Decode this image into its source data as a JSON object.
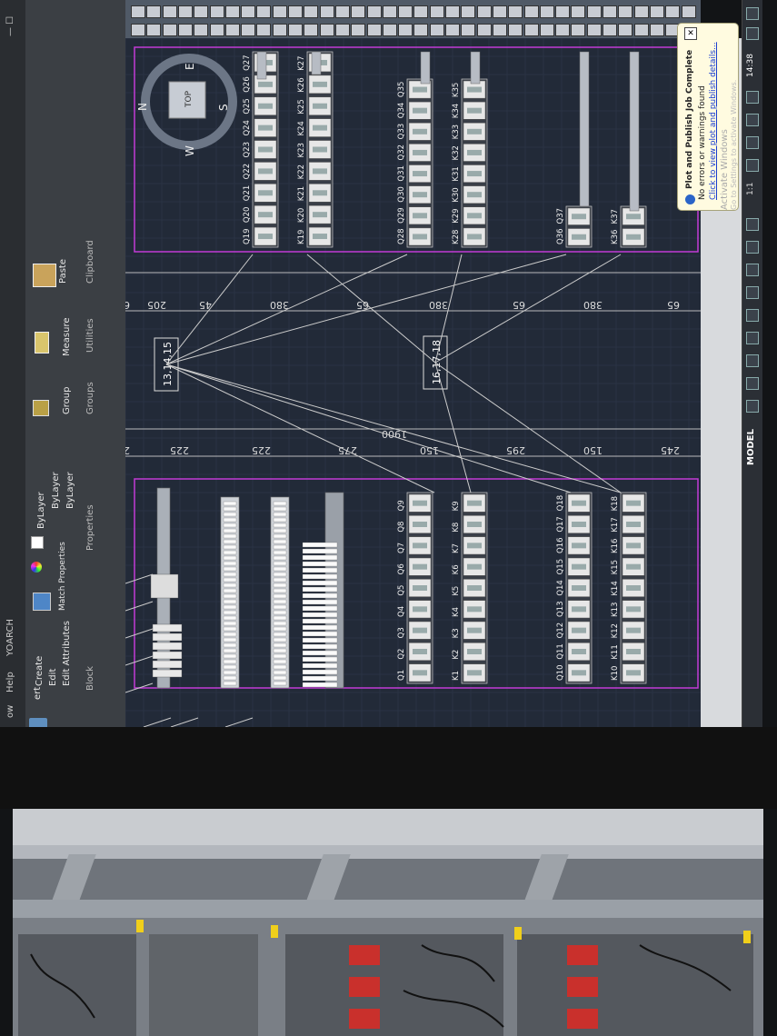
{
  "window": {
    "title_fragment": "YOARCH",
    "menu_help": "Help",
    "menu_window": "ow"
  },
  "ribbon": {
    "block_group": {
      "create": "Create",
      "edit": "Edit",
      "edit_attributes": "Edit Attributes",
      "group_label": "Block",
      "insert_partial": "ert"
    },
    "properties_group": {
      "match_properties": "Match\nProperties",
      "layer_1": "ByLayer",
      "layer_2": "ByLayer",
      "layer_3": "ByLayer",
      "group_label": "Properties"
    },
    "groups_group": {
      "group_button": "Group",
      "group_label": "Groups"
    },
    "utilities_group": {
      "measure": "Measure",
      "group_label": "Utilities"
    },
    "clipboard_group": {
      "paste": "Paste",
      "group_label": "Clipboard"
    }
  },
  "viewcube": {
    "top": "TOP",
    "north": "N",
    "south": "S",
    "east": "E",
    "west": "W"
  },
  "drawing": {
    "top_panel": {
      "row_q_top": [
        "Q19",
        "Q20",
        "Q21",
        "Q22",
        "Q23",
        "Q24",
        "Q25",
        "Q26",
        "Q27"
      ],
      "row_k_top": [
        "K19",
        "K20",
        "K21",
        "K22",
        "K23",
        "K24",
        "K25",
        "K26",
        "K27"
      ],
      "row_q_mid": [
        "Q28",
        "Q29",
        "Q30",
        "Q31",
        "Q32",
        "Q33",
        "Q34",
        "Q35"
      ],
      "row_k_mid": [
        "K28",
        "K29",
        "K30",
        "K31",
        "K32",
        "K33",
        "K34",
        "K35"
      ],
      "row_q_right": [
        "Q36",
        "Q37"
      ],
      "row_k_right": [
        "K36",
        "K37"
      ],
      "dimensions": [
        "205",
        "45",
        "380",
        "65",
        "380",
        "65",
        "380",
        "65",
        "6"
      ]
    },
    "bottom_panel": {
      "row_q_left": [
        "Q1",
        "Q2",
        "Q3",
        "Q4",
        "Q5",
        "Q6",
        "Q7",
        "Q8",
        "Q9"
      ],
      "row_k_left": [
        "K1",
        "K2",
        "K3",
        "K4",
        "K5",
        "K6",
        "K7",
        "K8",
        "K9"
      ],
      "row_q_right": [
        "Q10",
        "Q11",
        "Q12",
        "Q13",
        "Q14",
        "Q15",
        "Q16",
        "Q17",
        "Q18"
      ],
      "row_k_right": [
        "K10",
        "K11",
        "K12",
        "K13",
        "K14",
        "K15",
        "K16",
        "K17",
        "K18"
      ],
      "dimensions": [
        "2",
        "225",
        "225",
        "275",
        "150",
        "295",
        "150",
        "245"
      ],
      "overall": "1900"
    },
    "callouts": [
      "13,14,15",
      "16,17,18"
    ]
  },
  "notification": {
    "title": "Plot and Publish Job Complete",
    "message": "No errors or warnings found",
    "link": "Click to view plot and publish details...",
    "close": "✕",
    "watermark_1": "Activate Windows",
    "watermark_2": "Go to Settings to activate Windows."
  },
  "status_bar": {
    "model": "MODEL",
    "scale": "1:1",
    "time": "14:38"
  },
  "colors": {
    "canvas": "#222a38",
    "panel_outline": "#c13bd6",
    "rail": "#d0d0d0",
    "component": "#e8e8e8",
    "notify_bg": "#fffbe0"
  }
}
